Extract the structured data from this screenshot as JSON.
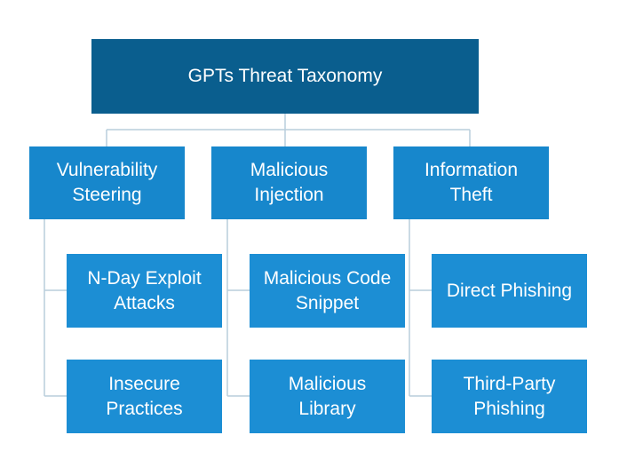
{
  "title": "GPTs Threat Taxonomy",
  "categories": [
    {
      "label": "Vulnerability\nSteering",
      "children": [
        "N-Day Exploit\nAttacks",
        "Insecure\nPractices"
      ]
    },
    {
      "label": "Malicious\nInjection",
      "children": [
        "Malicious Code\nSnippet",
        "Malicious\nLibrary"
      ]
    },
    {
      "label": "Information\nTheft",
      "children": [
        "Direct Phishing",
        "Third-Party\nPhishing"
      ]
    }
  ],
  "colors": {
    "root": "#0a5e8e",
    "category": "#1787cc",
    "leaf": "#1c8ed4",
    "connector": "#b9cedc"
  }
}
